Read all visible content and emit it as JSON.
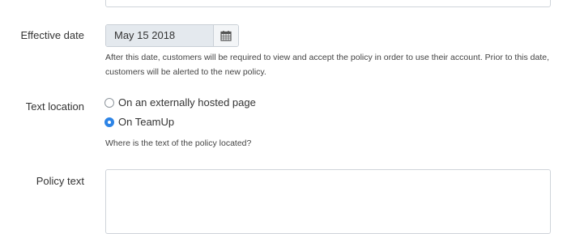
{
  "effective_date": {
    "label": "Effective date",
    "value": "May 15 2018",
    "calendar_icon": "calendar-icon",
    "help_line1": "After this date, customers will be required to view and accept the policy in order to use their account. Prior to this date,",
    "help_line2": "customers will be alerted to the new policy."
  },
  "text_location": {
    "label": "Text location",
    "options": [
      {
        "label": "On an externally hosted page",
        "selected": false
      },
      {
        "label": "On TeamUp",
        "selected": true
      }
    ],
    "help": "Where is the text of the policy located?"
  },
  "policy_text": {
    "label": "Policy text",
    "value": ""
  },
  "colors": {
    "radio_selected": "#2d84e6",
    "date_field_bg": "#e4e9ee"
  }
}
